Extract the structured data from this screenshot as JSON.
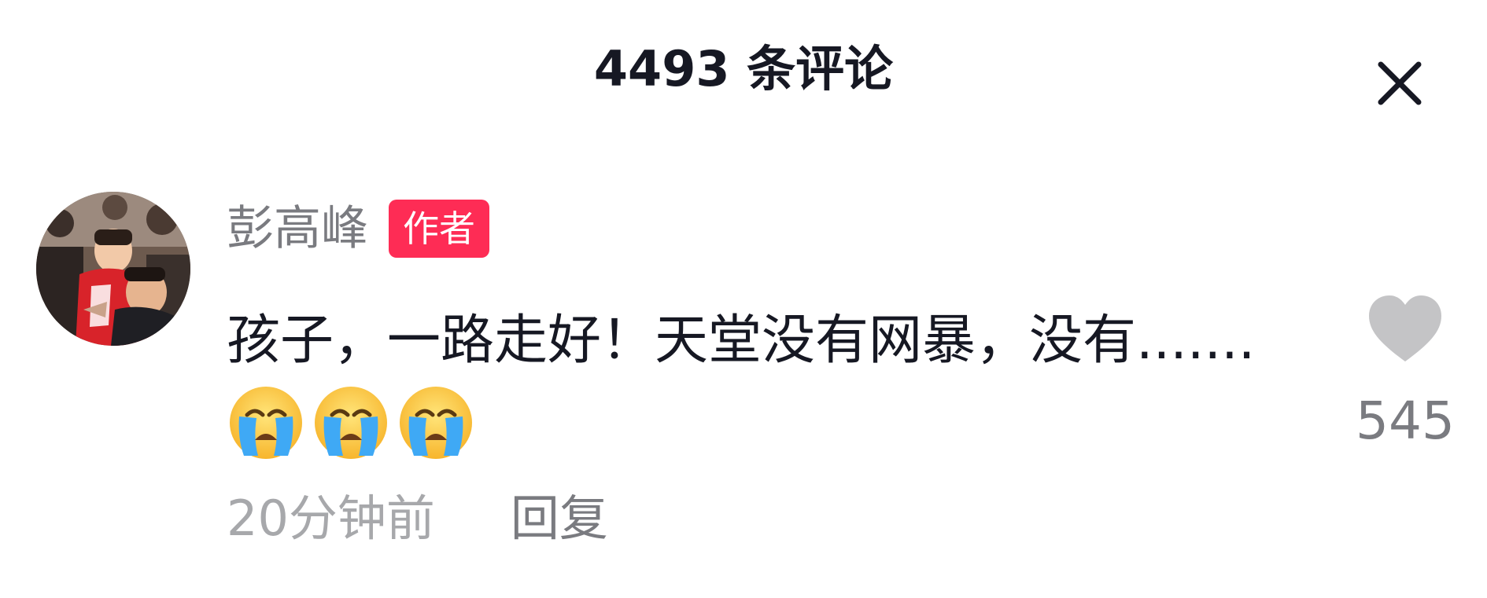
{
  "header": {
    "title": "4493 条评论",
    "close_icon": "close-icon"
  },
  "comment": {
    "avatar_icon": "avatar-photo",
    "author_name": "彭高峰",
    "author_badge": "作者",
    "badge_color": "#fe2c55",
    "text": "孩子，一路走好！天堂没有网暴，没有.......",
    "emoji": [
      "loudly-crying-face",
      "loudly-crying-face",
      "loudly-crying-face"
    ],
    "time": "20分钟前",
    "reply_label": "回复",
    "like_icon": "heart-icon",
    "like_count": "545"
  }
}
